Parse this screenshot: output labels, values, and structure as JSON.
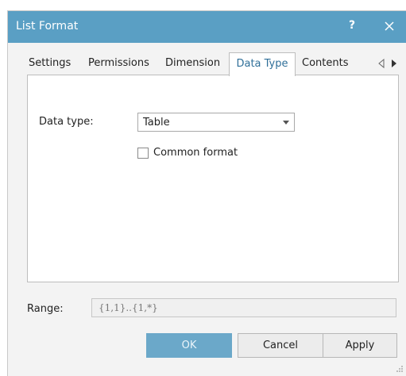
{
  "window": {
    "title": "List Format",
    "help_label": "?"
  },
  "tabs": [
    {
      "label": "Settings"
    },
    {
      "label": "Permissions"
    },
    {
      "label": "Dimension"
    },
    {
      "label": "Data Type",
      "active": true
    },
    {
      "label": "Contents"
    }
  ],
  "data_type": {
    "label": "Data type:",
    "selected": "Table",
    "common_format_label": "Common format",
    "common_format_checked": false
  },
  "range": {
    "label": "Range:",
    "value": "{1,1}..{1,*}"
  },
  "buttons": {
    "ok": "OK",
    "cancel": "Cancel",
    "apply": "Apply"
  },
  "colors": {
    "titlebar": "#5a9fc4",
    "active_tab_text": "#2f6f99",
    "ok_button": "#6ba8c9"
  },
  "icons": {
    "close": "close-icon",
    "tab_prev": "chevron-left-icon",
    "tab_next": "chevron-right-icon",
    "dropdown": "chevron-down-icon",
    "resize": "resize-grip-icon"
  }
}
